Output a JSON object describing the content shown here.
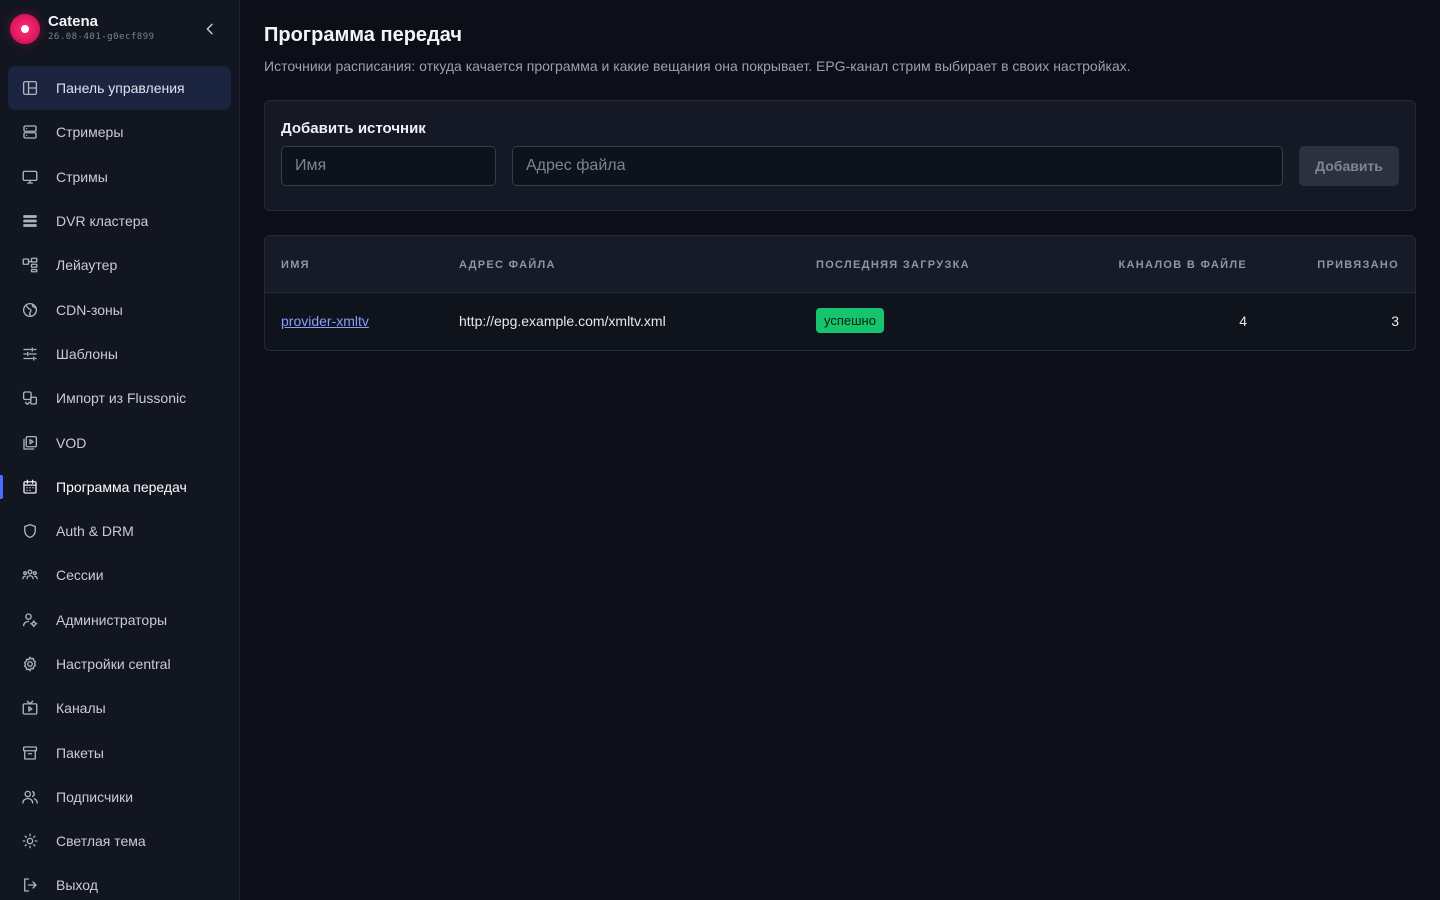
{
  "app": {
    "name": "Catena",
    "version": "26.08-401-g0ecf899",
    "collapse_icon": "chevron-left-icon"
  },
  "sidebar": {
    "items": [
      {
        "label": "Панель управления",
        "icon": "dashboard-icon",
        "state": "hover"
      },
      {
        "label": "Стримеры",
        "icon": "server-icon"
      },
      {
        "label": "Стримы",
        "icon": "monitor-icon"
      },
      {
        "label": "DVR кластера",
        "icon": "storage-icon"
      },
      {
        "label": "Лейаутер",
        "icon": "layout-icon"
      },
      {
        "label": "CDN-зоны",
        "icon": "globe-icon"
      },
      {
        "label": "Шаблоны",
        "icon": "sliders-icon"
      },
      {
        "label": "Импорт из Flussonic",
        "icon": "import-icon"
      },
      {
        "label": "VOD",
        "icon": "video-library-icon"
      },
      {
        "label": "Программа передач",
        "icon": "calendar-icon",
        "state": "active"
      },
      {
        "label": "Auth & DRM",
        "icon": "shield-icon"
      },
      {
        "label": "Сессии",
        "icon": "users-group-icon"
      },
      {
        "label": "Администраторы",
        "icon": "user-gear-icon"
      },
      {
        "label": "Настройки central",
        "icon": "gear-icon"
      },
      {
        "label": "Каналы",
        "icon": "tv-icon"
      },
      {
        "label": "Пакеты",
        "icon": "archive-icon"
      },
      {
        "label": "Подписчики",
        "icon": "users-icon"
      },
      {
        "label": "Светлая тема",
        "icon": "sun-icon"
      },
      {
        "label": "Выход",
        "icon": "logout-icon"
      }
    ]
  },
  "page": {
    "title": "Программа передач",
    "subtitle": "Источники расписания: откуда качается программа и какие вещания она покрывает. EPG-канал стрим выбирает в своих настройках."
  },
  "add_source": {
    "title": "Добавить источник",
    "name_placeholder": "Имя",
    "name_value": "",
    "url_placeholder": "Адрес файла",
    "url_value": "",
    "button_label": "Добавить"
  },
  "table": {
    "columns": [
      "ИМЯ",
      "АДРЕС ФАЙЛА",
      "ПОСЛЕДНЯЯ ЗАГРУЗКА",
      "КАНАЛОВ В ФАЙЛЕ",
      "ПРИВЯЗАНО"
    ],
    "rows": [
      {
        "name": "provider-xmltv",
        "url": "http://epg.example.com/xmltv.xml",
        "last_load": "успешно",
        "channels_in_file": "4",
        "bound": "3"
      }
    ]
  },
  "colors": {
    "accent": "#4f6bff",
    "success": "#16c46e",
    "link": "#8c9cff",
    "brand": "#e8175f"
  }
}
